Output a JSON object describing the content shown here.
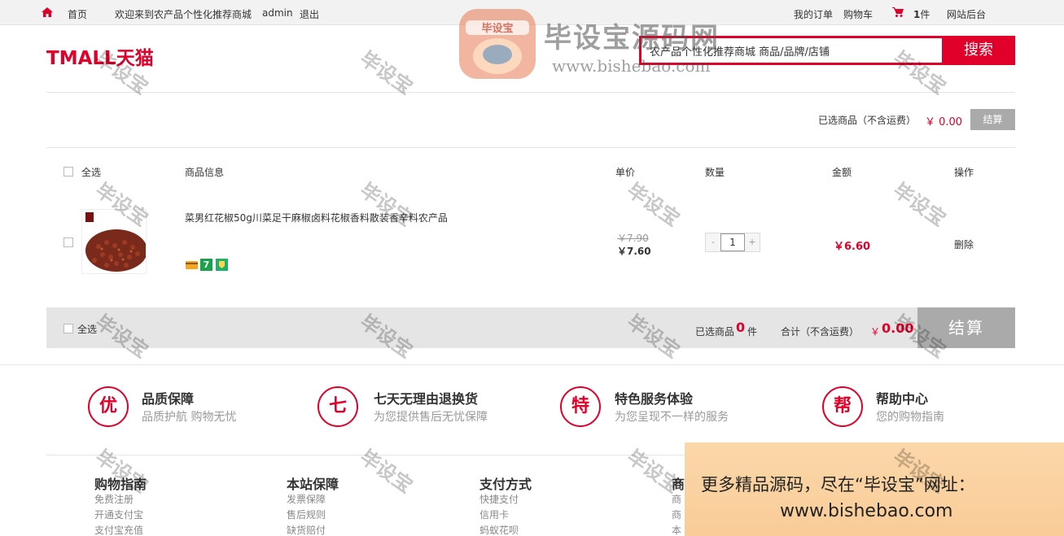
{
  "topbar": {
    "home": "首页",
    "welcome": "欢迎来到农产品个性化推荐商城",
    "user": "admin",
    "logout": "退出",
    "my_orders": "我的订单",
    "cart": "购物车",
    "cart_count": "1",
    "cart_unit": "件",
    "admin_panel": "网站后台"
  },
  "header": {
    "logo": "TMALL天猫",
    "search_value": "农产品个性化推荐商城 商品/品牌/店铺",
    "search_button": "搜索"
  },
  "summary_top": {
    "label": "已选商品（不含运费）",
    "price": "￥ 0.00",
    "button": "结算"
  },
  "table_headers": {
    "select_all": "全选",
    "info": "商品信息",
    "unit_price": "单价",
    "quantity": "数量",
    "amount": "金额",
    "operation": "操作"
  },
  "item": {
    "name": "菜男红花椒50g川菜足干麻椒卤料花椒香料散装香辛料农产品",
    "old_price": "￥7.90",
    "new_price": "￥7.60",
    "minus": "-",
    "quantity": "1",
    "plus": "+",
    "amount": "￥6.60",
    "delete": "删除",
    "badge_seven": "7"
  },
  "bottom_bar": {
    "select_all": "全选",
    "selected_prefix": "已选商品",
    "selected_count": "0",
    "selected_unit": "件",
    "total_label": "合计（不含运费）",
    "currency": "￥",
    "total": "0.00",
    "settle": "结算"
  },
  "guarantees": [
    {
      "icon": "优",
      "title": "品质保障",
      "sub": "品质护航 购物无忧"
    },
    {
      "icon": "七",
      "title": "七天无理由退换货",
      "sub": "为您提供售后无忧保障"
    },
    {
      "icon": "特",
      "title": "特色服务体验",
      "sub": "为您呈现不一样的服务"
    },
    {
      "icon": "帮",
      "title": "帮助中心",
      "sub": "您的购物指南"
    }
  ],
  "footer": [
    {
      "title": "购物指南",
      "links": [
        "免费注册",
        "开通支付宝",
        "支付宝充值"
      ]
    },
    {
      "title": "本站保障",
      "links": [
        "发票保障",
        "售后规则",
        "缺货赔付"
      ]
    },
    {
      "title": "支付方式",
      "links": [
        "快捷支付",
        "信用卡",
        "蚂蚁花呗"
      ]
    },
    {
      "title": "商",
      "links": [
        "商",
        "商",
        "本"
      ]
    }
  ],
  "watermarks": {
    "text": "毕设宝",
    "brand": "毕设宝源码网",
    "brand_url": "www.bishebao.com",
    "mascot": "毕设宝"
  },
  "ad": {
    "line1": "更多精品源码，尽在“毕设宝”网址：",
    "line2": "www.bishebao.com"
  },
  "colors": {
    "accent": "#e0002a",
    "gray_button": "#aaaaaa",
    "ad_bg": "#f9cc98"
  }
}
